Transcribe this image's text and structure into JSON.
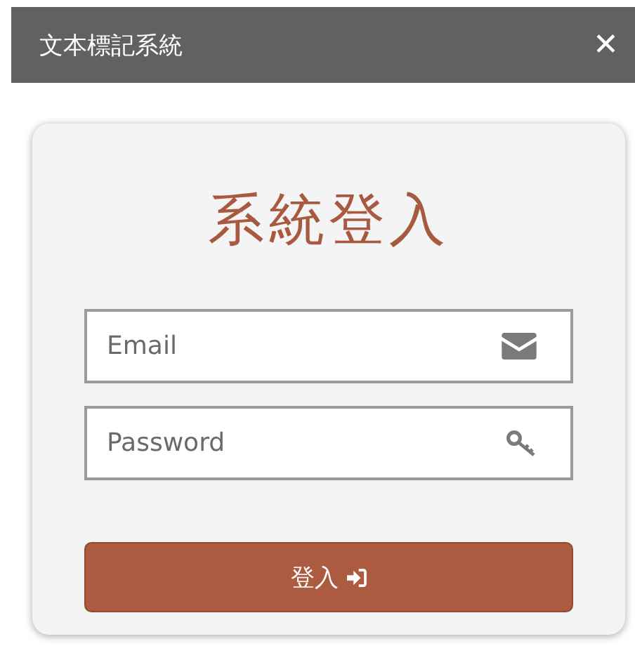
{
  "window": {
    "title": "文本標記系統",
    "close": "✕"
  },
  "login": {
    "heading": "系統登入",
    "fields": [
      {
        "kind": "email",
        "placeholder": "Email"
      },
      {
        "kind": "password",
        "placeholder": "Password"
      }
    ],
    "button": {
      "label": "登入"
    }
  }
}
